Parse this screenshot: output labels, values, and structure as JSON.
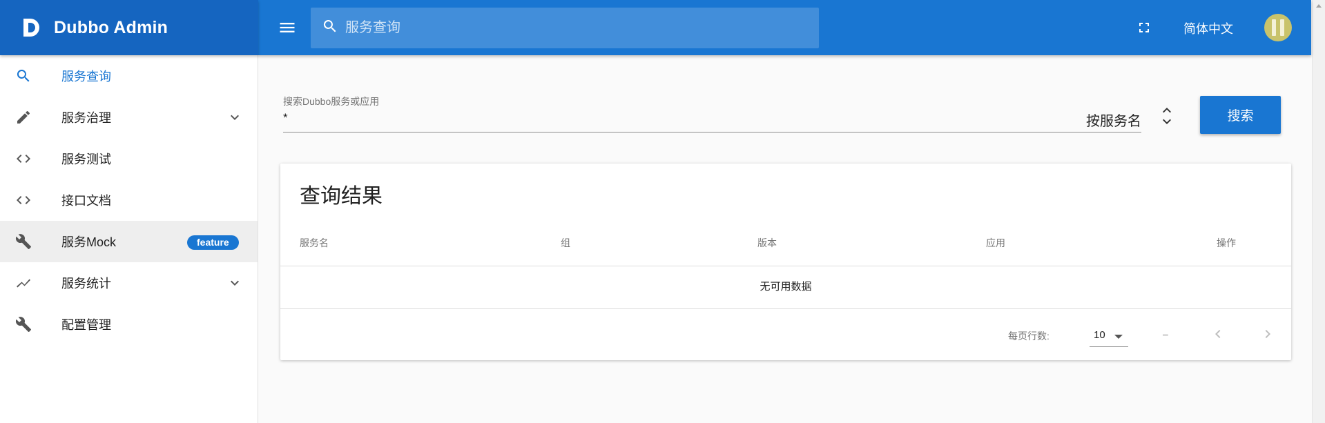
{
  "brand": {
    "title": "Dubbo Admin"
  },
  "topbar": {
    "search_placeholder": "服务查询",
    "language": "简体中文"
  },
  "sidebar": {
    "items": [
      {
        "label": "服务查询",
        "icon": "search-icon",
        "active": true
      },
      {
        "label": "服务治理",
        "icon": "pencil-icon",
        "expandable": true
      },
      {
        "label": "服务测试",
        "icon": "code-icon"
      },
      {
        "label": "接口文档",
        "icon": "code-icon"
      },
      {
        "label": "服务Mock",
        "icon": "wrench-icon",
        "badge": "feature"
      },
      {
        "label": "服务统计",
        "icon": "trending-up-icon",
        "expandable": true
      },
      {
        "label": "配置管理",
        "icon": "wrench-icon"
      }
    ]
  },
  "search": {
    "label": "搜索Dubbo服务或应用",
    "value": "*",
    "type": "按服务名",
    "button": "搜索"
  },
  "results": {
    "title": "查询结果",
    "columns": [
      "服务名",
      "组",
      "版本",
      "应用",
      "操作"
    ],
    "empty_text": "无可用数据",
    "rows_per_page_label": "每页行数:",
    "rows_per_page": "10",
    "range": "–"
  },
  "colors": {
    "primary": "#1976d2",
    "brand": "#1565c0"
  }
}
